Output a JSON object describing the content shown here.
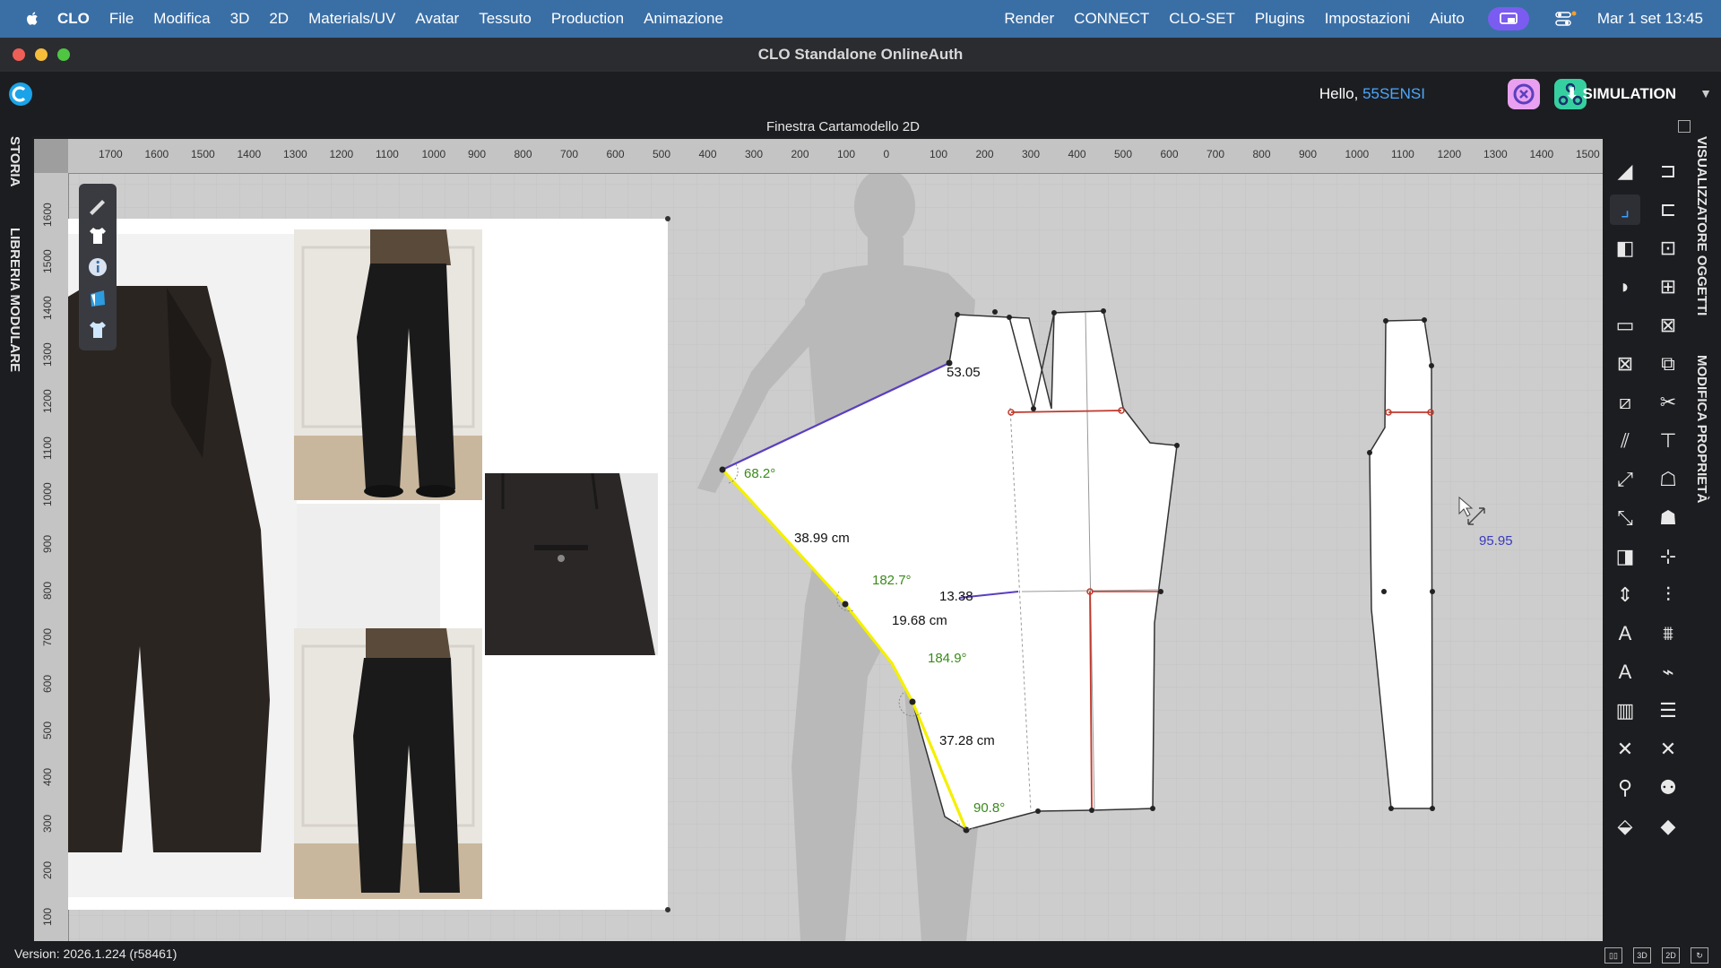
{
  "menubar": {
    "items": [
      "CLO",
      "File",
      "Modifica",
      "3D",
      "2D",
      "Materials/UV",
      "Avatar",
      "Tessuto",
      "Production",
      "Animazione"
    ],
    "right_items": [
      "Render",
      "CONNECT",
      "CLO-SET",
      "Plugins",
      "Impostazioni",
      "Aiuto"
    ],
    "datetime": "Mar 1 set  13:45"
  },
  "window": {
    "title": "CLO Standalone OnlineAuth"
  },
  "appbar": {
    "hello": "Hello, ",
    "username": "55SENSI",
    "mode": "SIMULATION"
  },
  "pattern_window": {
    "title": "Finestra Cartamodello 2D"
  },
  "left_tabs": [
    "STORIA",
    "LIBRERIA MODULARE"
  ],
  "right_tabs": [
    "VISUALIZZATORE OGGETTI",
    "MODIFICA PROPRIETÀ"
  ],
  "rulers": {
    "h_labels": [
      "1700",
      "1600",
      "1500",
      "1400",
      "1300",
      "1200",
      "1100",
      "1000",
      "900",
      "800",
      "700",
      "600",
      "500",
      "400",
      "300",
      "200",
      "100",
      "0",
      "100",
      "200",
      "300",
      "400",
      "500",
      "600",
      "700",
      "800",
      "900",
      "1000",
      "1100",
      "1200",
      "1300",
      "1400",
      "1500"
    ],
    "v_labels": [
      "1600",
      "1500",
      "1400",
      "1300",
      "1200",
      "1100",
      "1000",
      "900",
      "800",
      "700",
      "600",
      "500",
      "400",
      "300",
      "200",
      "100"
    ]
  },
  "measurements": {
    "top_length": "53.05",
    "angle_left": "68.2°",
    "seg1": "38.99 cm",
    "angle2": "182.7°",
    "seg2": "19.68 cm",
    "angle3": "184.9°",
    "seg3": "37.28 cm",
    "angle_bottom": "90.8°",
    "mid": "13.38",
    "cursor_value": "95.95"
  },
  "status": {
    "version": "Version: 2026.1.224 (r58461)"
  },
  "colors": {
    "menubar": "#3a6fa6",
    "highlight": "#f4f000",
    "selection": "#5b3fbf",
    "angle": "#3a8a1a",
    "seam": "#c0392b"
  }
}
